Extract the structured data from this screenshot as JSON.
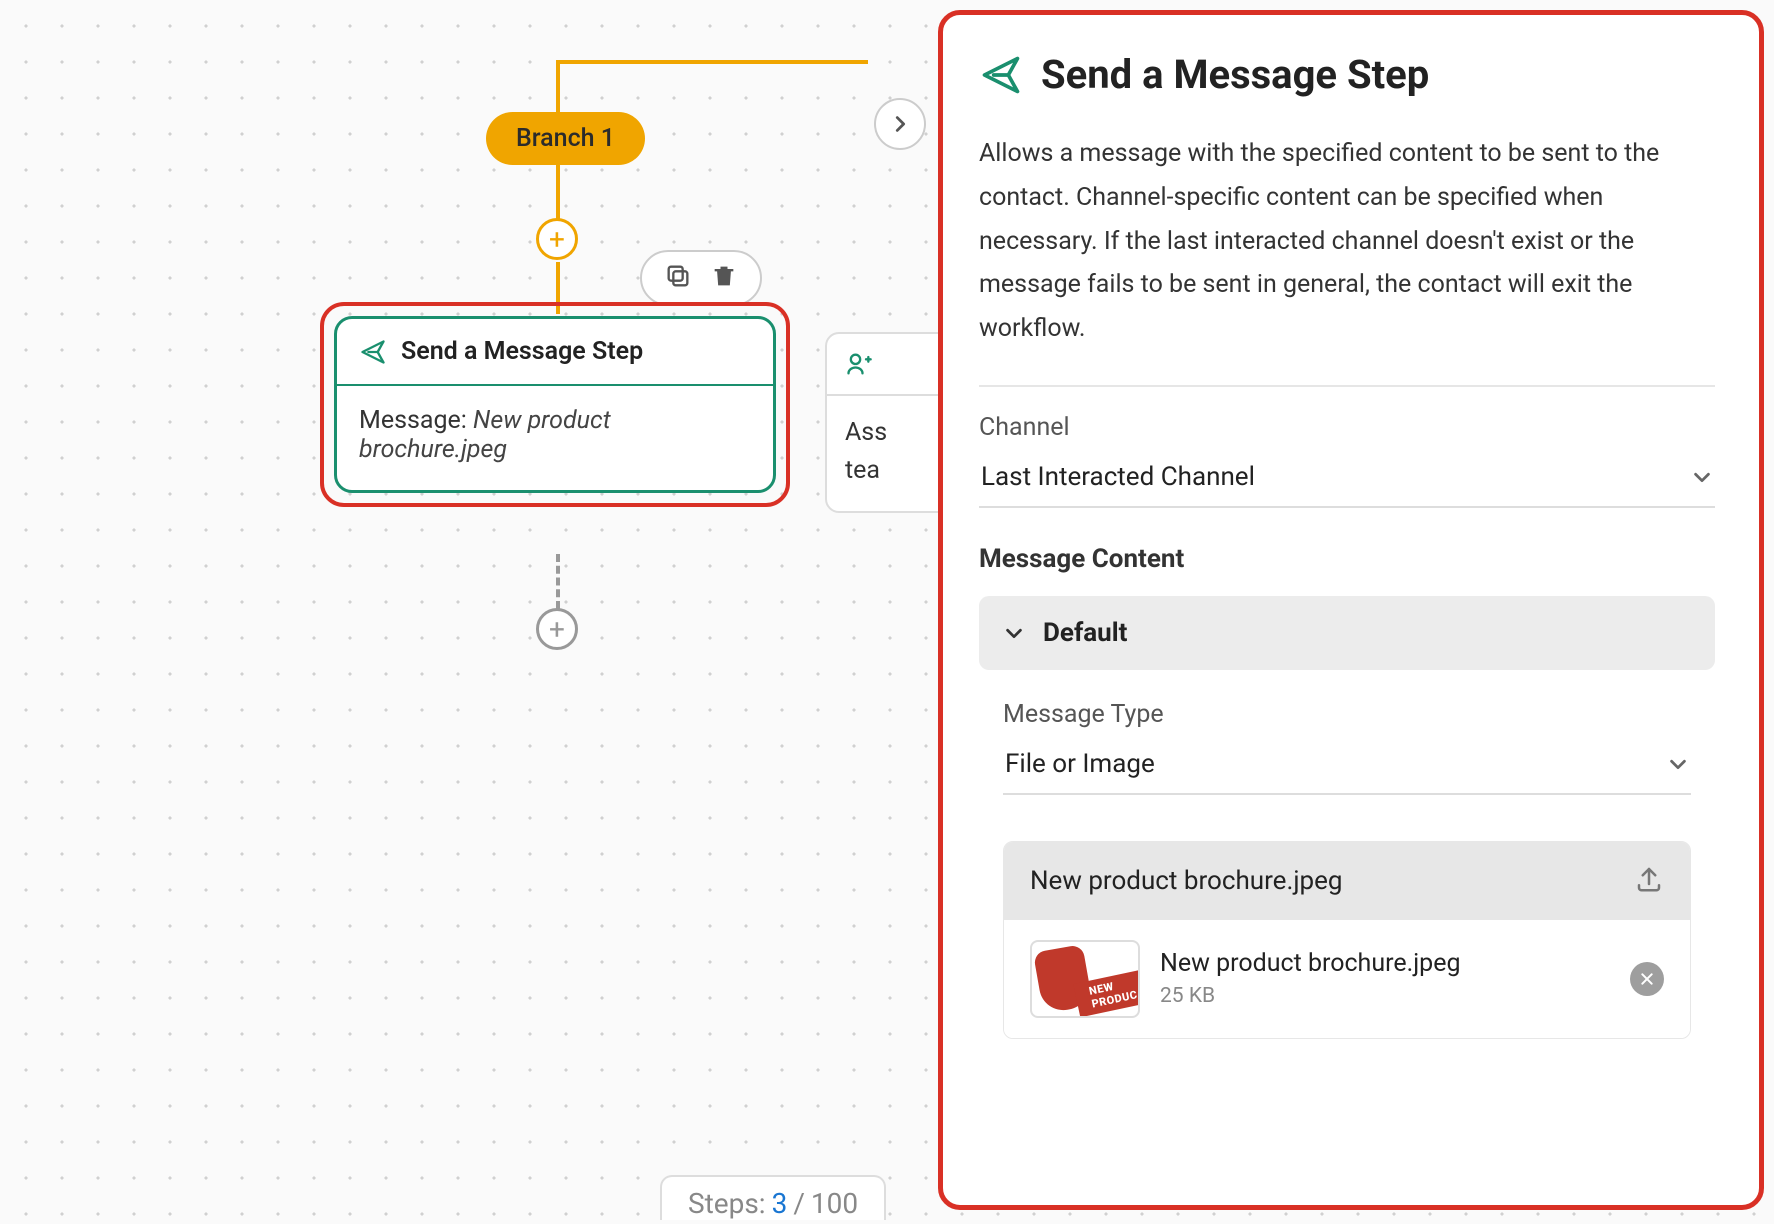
{
  "branch": {
    "label": "Branch 1"
  },
  "node": {
    "title": "Send a Message Step",
    "message_prefix": "Message: ",
    "message_value": "New product brochure.jpeg"
  },
  "adjacent": {
    "line1": "Ass",
    "line2": "tea"
  },
  "panel": {
    "title": "Send a Message Step",
    "description": "Allows a message with the specified content to be sent to the contact. Channel-specific content can be specified when necessary. If the last interacted channel doesn't exist or the message fails to be sent in general, the contact will exit the workflow.",
    "channel_label": "Channel",
    "channel_value": "Last Interacted Channel",
    "content_section": "Message Content",
    "accordion_label": "Default",
    "message_type_label": "Message Type",
    "message_type_value": "File or Image",
    "file": {
      "name_header": "New product brochure.jpeg",
      "name": "New product brochure.jpeg",
      "size": "25 KB",
      "thumb_text1": "NEW",
      "thumb_text2": "PRODUC"
    }
  },
  "footer": {
    "label": "Steps:",
    "count": "3",
    "sep": " / ",
    "total": "100"
  }
}
